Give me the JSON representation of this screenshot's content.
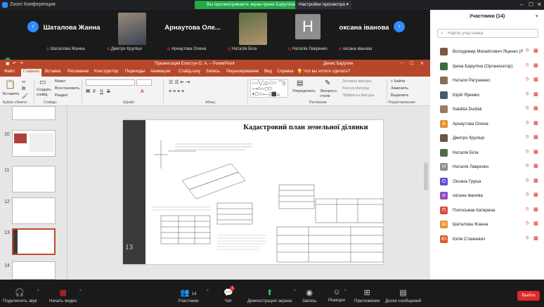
{
  "window": {
    "title": "Zoom Конференция",
    "share_banner": "Вы просматриваете экран Ірина Барулїна",
    "view_options": "Настройки просмотра ▾"
  },
  "video_strip": [
    {
      "display": "Шаталова Жанна",
      "label": "Шаталова Жанна",
      "kind": "name"
    },
    {
      "display": "",
      "label": "Дмитро Круліця",
      "kind": "photo"
    },
    {
      "display": "Арнаутова Оле...",
      "label": "Арнаутова Олена",
      "kind": "name"
    },
    {
      "display": "",
      "label": "Наталія Біла",
      "kind": "photo2"
    },
    {
      "display": "Н",
      "label": "Наталія Лавренко",
      "kind": "letter"
    },
    {
      "display": "оксана іванова",
      "label": "оксана іванова",
      "kind": "name"
    }
  ],
  "ppt": {
    "doc_title": "Презентация Елистун О. А. – PowerPoint",
    "user": "Денис Барулин",
    "tabs": [
      "Файл",
      "Главная",
      "Вставка",
      "Рисование",
      "Конструктор",
      "Переходы",
      "Анимация",
      "Слайд-шоу",
      "Запись",
      "Рецензирование",
      "Вид",
      "Справка",
      "Что вы хотите сделать?"
    ],
    "active_tab": "Главная",
    "ribbon": {
      "paste": "Вставить",
      "clipboard": "Буфер обмена",
      "new_slide": "Создать слайд",
      "layout": "Макет",
      "reset": "Восстановить",
      "section": "Раздел",
      "slides": "Слайды",
      "font": "Шрифт",
      "paragraph": "Абзац",
      "arrange": "Упорядочить",
      "express": "Экспресс-стили",
      "shape_fill": "Заливка фигуры",
      "shape_outline": "Контур фигуры",
      "shape_effects": "Эффекты фигуры",
      "drawing": "Рисование",
      "find": "Найти",
      "replace": "Заменить",
      "select": "Выделить",
      "editing": "Редактирование"
    },
    "thumb_numbers": [
      "10",
      "11",
      "12",
      "13",
      "14"
    ],
    "slide_number": "13",
    "slide_title": "Кадастровий план земельної ділянки"
  },
  "participants": {
    "header": "Участники (14)",
    "search_placeholder": "Найти участника",
    "list": [
      {
        "name": "Володимир Михайлович Яценко (Я)",
        "initial": "",
        "color": "#7b5a3c"
      },
      {
        "name": "Ірина Барулїна (Организатор)",
        "initial": "",
        "color": "#3d6b3a"
      },
      {
        "name": "Натали Рагушенко",
        "initial": "",
        "color": "#8a6d55"
      },
      {
        "name": "Юрій Яремко",
        "initial": "",
        "color": "#4a5a6b"
      },
      {
        "name": "Nataliia Dudiak",
        "initial": "",
        "color": "#a07b62"
      },
      {
        "name": "Арнаутова Олена",
        "initial": "А",
        "color": "#e8912d"
      },
      {
        "name": "Дмитро Круліця",
        "initial": "",
        "color": "#6b5444"
      },
      {
        "name": "Наталія Біла",
        "initial": "",
        "color": "#556a4a"
      },
      {
        "name": "Наталія Лавренко",
        "initial": "Н",
        "color": "#8e8e8e"
      },
      {
        "name": "Оксана Груша",
        "initial": "О",
        "color": "#5b4fd6"
      },
      {
        "name": "оксана іванова",
        "initial": "о",
        "color": "#8f4fc0"
      },
      {
        "name": "Полосьмак Катерина",
        "initial": "П",
        "color": "#d94a3a"
      },
      {
        "name": "Шаталова Жанна",
        "initial": "Ш",
        "color": "#e8912d"
      },
      {
        "name": "Юлія Станкевич",
        "initial": "Ю",
        "color": "#d95a2a"
      }
    ]
  },
  "toolbar": {
    "audio": "Подключить звук",
    "video": "Начать видео",
    "participants": "Участники",
    "participants_count": "14",
    "chat": "Чат",
    "chat_badge": "1",
    "share": "Демонстрация экрана",
    "record": "Запись",
    "reactions": "Реакции",
    "apps": "Приложения",
    "whiteboards": "Доски сообщений",
    "leave": "Выйти"
  }
}
